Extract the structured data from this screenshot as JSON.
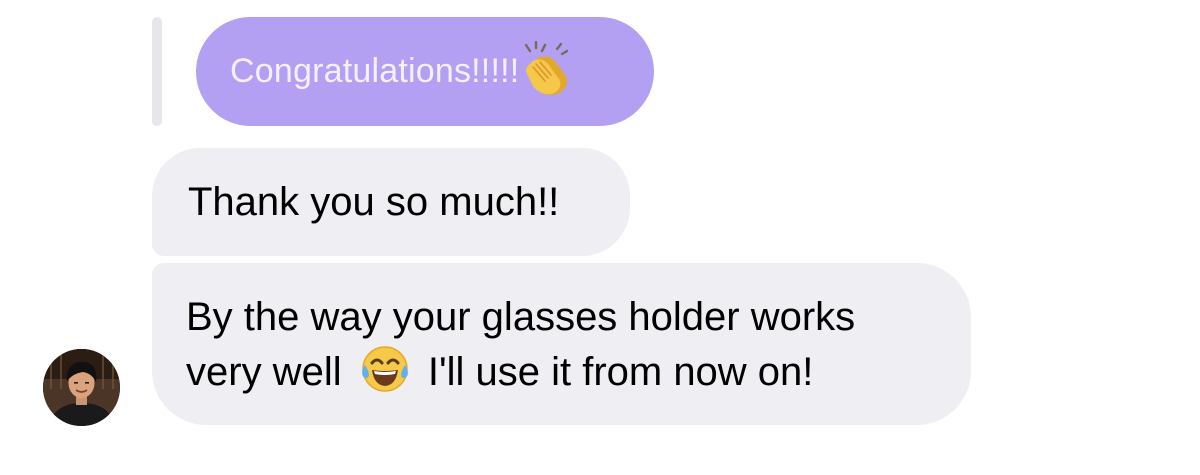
{
  "thread": {
    "quoted_message": {
      "text": "Congratulations!!!!!",
      "emoji": "clapping-hands",
      "color": "#b3a0f2"
    },
    "messages": [
      {
        "text": "Thank you so much!!"
      },
      {
        "line1": "By the way your glasses holder works",
        "line2_before": "very well",
        "line2_emoji": "face-with-tears-of-joy",
        "line2_after": "I'll use it from now on!"
      }
    ],
    "incoming_bubble_color": "#eeeef3",
    "sender_avatar": "profile-photo"
  }
}
